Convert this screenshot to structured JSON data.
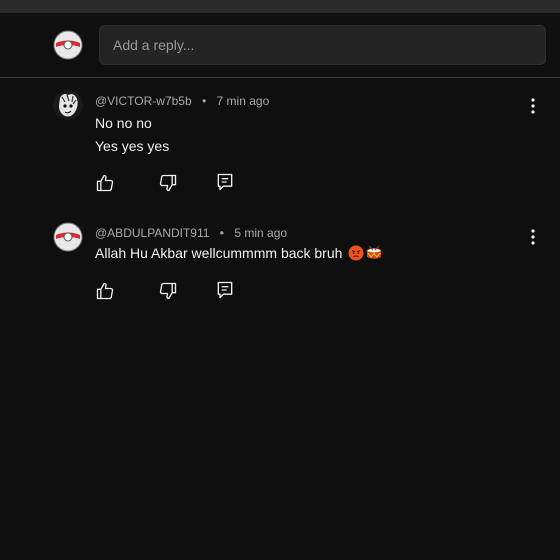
{
  "reply_box": {
    "placeholder": "Add a reply..."
  },
  "comments": [
    {
      "author": "@VICTOR-w7b5b",
      "separator": "•",
      "time": "7 min ago",
      "lines": [
        "No no no",
        "Yes yes yes"
      ]
    },
    {
      "author": "@ABDULPANDIT911",
      "separator": "•",
      "time": "5 min ago",
      "lines": [
        "Allah Hu Akbar wellcummmm back bruh"
      ],
      "emojis": [
        "angry-face-emoji",
        "drum-emoji"
      ]
    }
  ],
  "icons": {
    "like": "thumbs-up-icon",
    "dislike": "thumbs-down-icon",
    "reply": "reply-icon",
    "more": "more-vertical-icon"
  },
  "colors": {
    "background": "#0f0f0f",
    "input_bg": "#242424",
    "text": "#f1f1f1",
    "meta": "#aaaaaa"
  }
}
